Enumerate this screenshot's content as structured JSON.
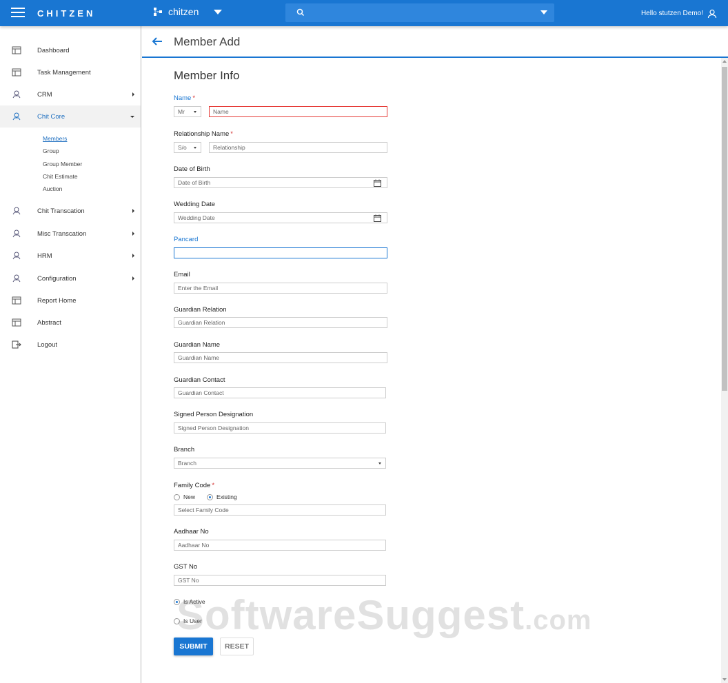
{
  "header": {
    "brand": "CHITZEN",
    "company": "chitzen",
    "greeting": "Hello stutzen Demo!"
  },
  "sidebar": {
    "items": [
      {
        "label": "Dashboard"
      },
      {
        "label": "Task Management"
      },
      {
        "label": "CRM"
      },
      {
        "label": "Chit Core"
      },
      {
        "label": "Chit Transcation"
      },
      {
        "label": "Misc Transcation"
      },
      {
        "label": "HRM"
      },
      {
        "label": "Configuration"
      },
      {
        "label": "Report Home"
      },
      {
        "label": "Abstract"
      },
      {
        "label": "Logout"
      }
    ],
    "sub_items": [
      {
        "label": "Members"
      },
      {
        "label": "Group"
      },
      {
        "label": "Group Member"
      },
      {
        "label": "Chit Estimate"
      },
      {
        "label": "Auction"
      }
    ]
  },
  "page": {
    "title": "Member Add",
    "section_title": "Member Info"
  },
  "form": {
    "name_label": "Name",
    "name_prefix": "Mr",
    "name_placeholder": "Name",
    "relationship_label": "Relationship Name",
    "relationship_prefix": "S/o",
    "relationship_placeholder": "Relationship",
    "dob_label": "Date of Birth",
    "dob_placeholder": "Date of Birth",
    "wedding_label": "Wedding Date",
    "wedding_placeholder": "Wedding Date",
    "pancard_label": "Pancard",
    "pancard_value": "",
    "email_label": "Email",
    "email_placeholder": "Enter the Email",
    "guardian_relation_label": "Guardian Relation",
    "guardian_relation_placeholder": "Guardian Relation",
    "guardian_name_label": "Guardian Name",
    "guardian_name_placeholder": "Guardian Name",
    "guardian_contact_label": "Guardian Contact",
    "guardian_contact_placeholder": "Guardian Contact",
    "signed_label": "Signed Person Designation",
    "signed_placeholder": "Signed Person Designation",
    "branch_label": "Branch",
    "branch_placeholder": "Branch",
    "family_code_label": "Family Code",
    "family_new": "New",
    "family_existing": "Existing",
    "family_code_placeholder": "Select Family Code",
    "aadhaar_label": "Aadhaar No",
    "aadhaar_placeholder": "Aadhaar No",
    "gst_label": "GST No",
    "gst_placeholder": "GST No",
    "is_active": "Is Active",
    "is_user": "Is User",
    "required_mark": "*",
    "submit": "SUBMIT",
    "reset": "RESET"
  },
  "watermark": {
    "main": "SoftwareSuggest",
    "suffix": ".com"
  },
  "colors": {
    "primary": "#1976d2",
    "required": "#d32f2f"
  }
}
